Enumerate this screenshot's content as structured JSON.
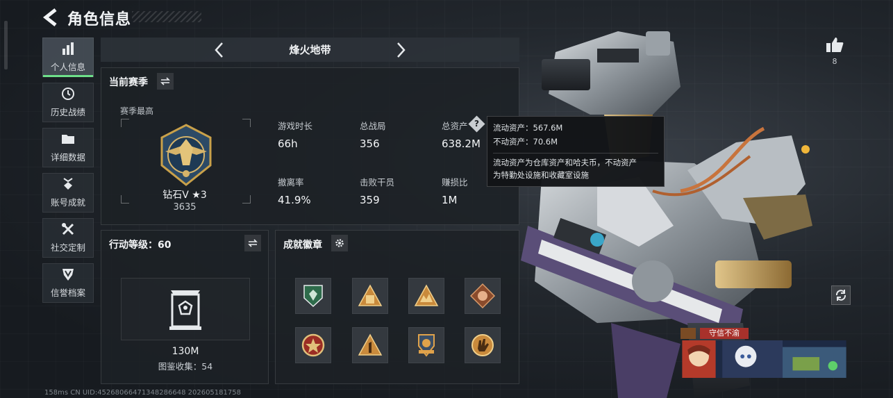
{
  "header": {
    "title": "角色信息"
  },
  "sidebar": {
    "items": [
      {
        "label": "个人信息",
        "icon": "bar-chart-icon",
        "active": true
      },
      {
        "label": "历史战绩",
        "icon": "clock-icon"
      },
      {
        "label": "详细数据",
        "icon": "folder-icon"
      },
      {
        "label": "账号成就",
        "icon": "medal-icon"
      },
      {
        "label": "社交定制",
        "icon": "tools-icon"
      },
      {
        "label": "信誉档案",
        "icon": "shield-icon"
      }
    ]
  },
  "mode": {
    "name": "烽火地带"
  },
  "season": {
    "title": "当前赛季",
    "subtitle": "赛季最高",
    "rank_name": "钻石V ★3",
    "rank_score": "3635",
    "stats": [
      {
        "label": "游戏时长",
        "value": "66h"
      },
      {
        "label": "总战局",
        "value": "356"
      },
      {
        "label": "总资产",
        "value": "638.2M"
      },
      {
        "label": "撤离率",
        "value": "41.9%"
      },
      {
        "label": "击败干员",
        "value": "359"
      },
      {
        "label": "赚损比",
        "value": "1M"
      }
    ]
  },
  "tooltip": {
    "liquid": "流动资产：567.6M",
    "fixed": "不动资产：70.6M",
    "desc1": "流动资产为仓库资产和哈夫币，不动资产",
    "desc2": "为特勤处设施和收藏室设施"
  },
  "action_level": {
    "title": "行动等级：60",
    "value": "130M",
    "collection": "图鉴收集：54"
  },
  "badges": {
    "title": "成就徽章"
  },
  "like": {
    "count": "8"
  },
  "honor": {
    "tag": "守信不渝"
  },
  "footer": {
    "text": "158ms   CN UID:45268066471348286648 202605181758"
  },
  "colors": {
    "accent": "#6ee08a",
    "gold": "#c9a14a",
    "tag_red": "#a8312b"
  }
}
